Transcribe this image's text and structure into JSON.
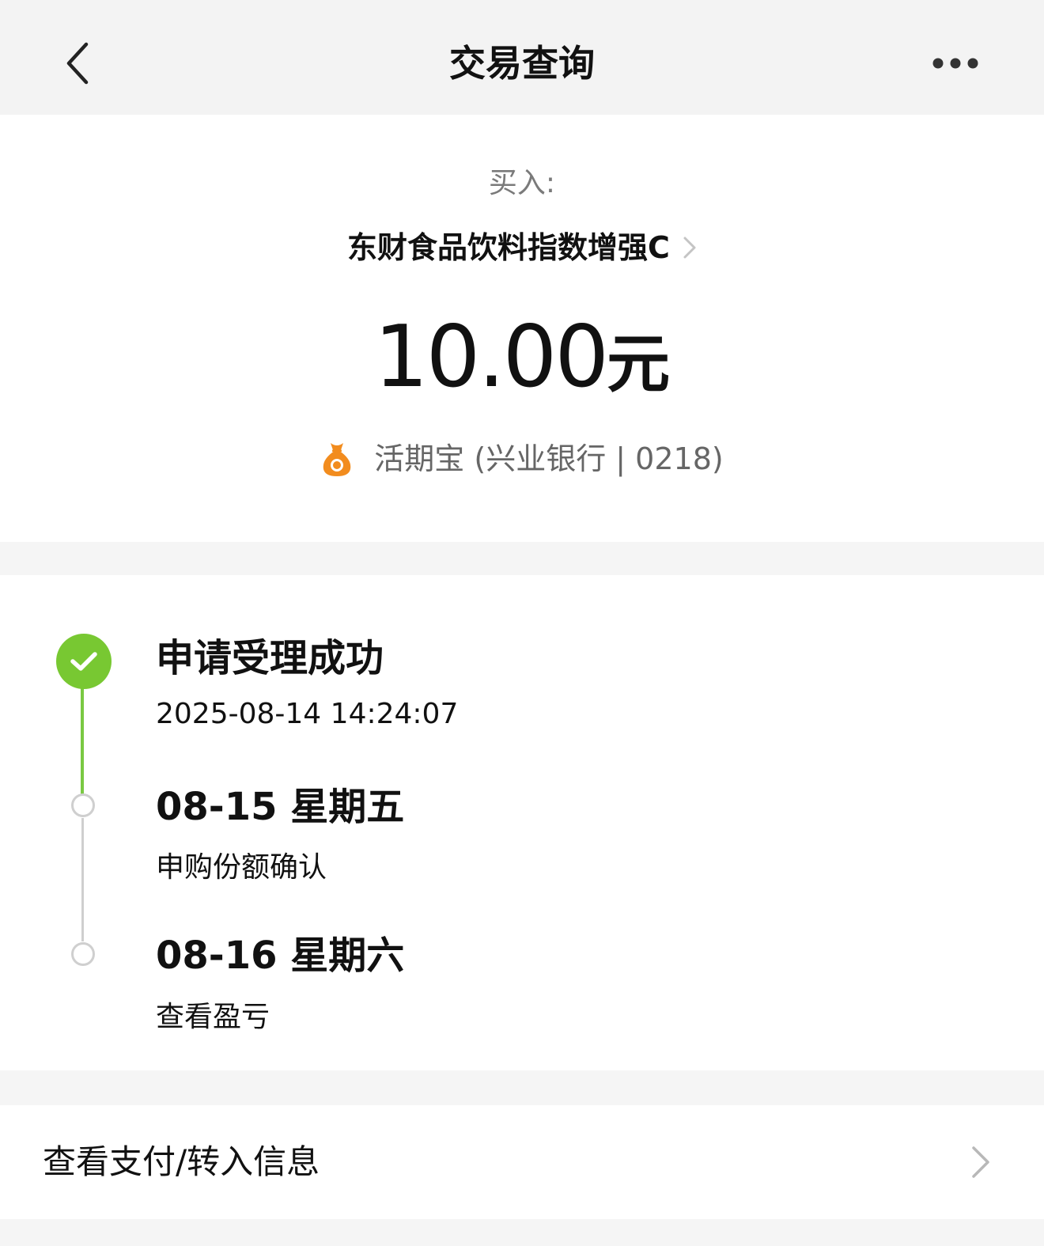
{
  "navbar": {
    "title": "交易查询",
    "back_icon": "chevron-left-icon",
    "more_icon": "more-dots-icon"
  },
  "summary": {
    "buy_label": "买入:",
    "fund_name": "东财食品饮料指数增强C",
    "amount": "10.00",
    "amount_unit": "元",
    "pay_icon": "money-bag-icon",
    "pay_method": "活期宝 (兴业银行 | 0218)",
    "pay_icon_color": "#f28c1e"
  },
  "timeline": {
    "accent_color": "#78c832",
    "steps": [
      {
        "title": "申请受理成功",
        "subtitle": "2025-08-14 14:24:07",
        "status": "done"
      },
      {
        "title": "08-15 星期五",
        "subtitle": "申购份额确认",
        "status": "pending"
      },
      {
        "title": "08-16 星期六",
        "subtitle": "查看盈亏",
        "status": "pending"
      }
    ]
  },
  "payment_info": {
    "label": "查看支付/转入信息",
    "chevron_icon": "chevron-right-icon"
  }
}
